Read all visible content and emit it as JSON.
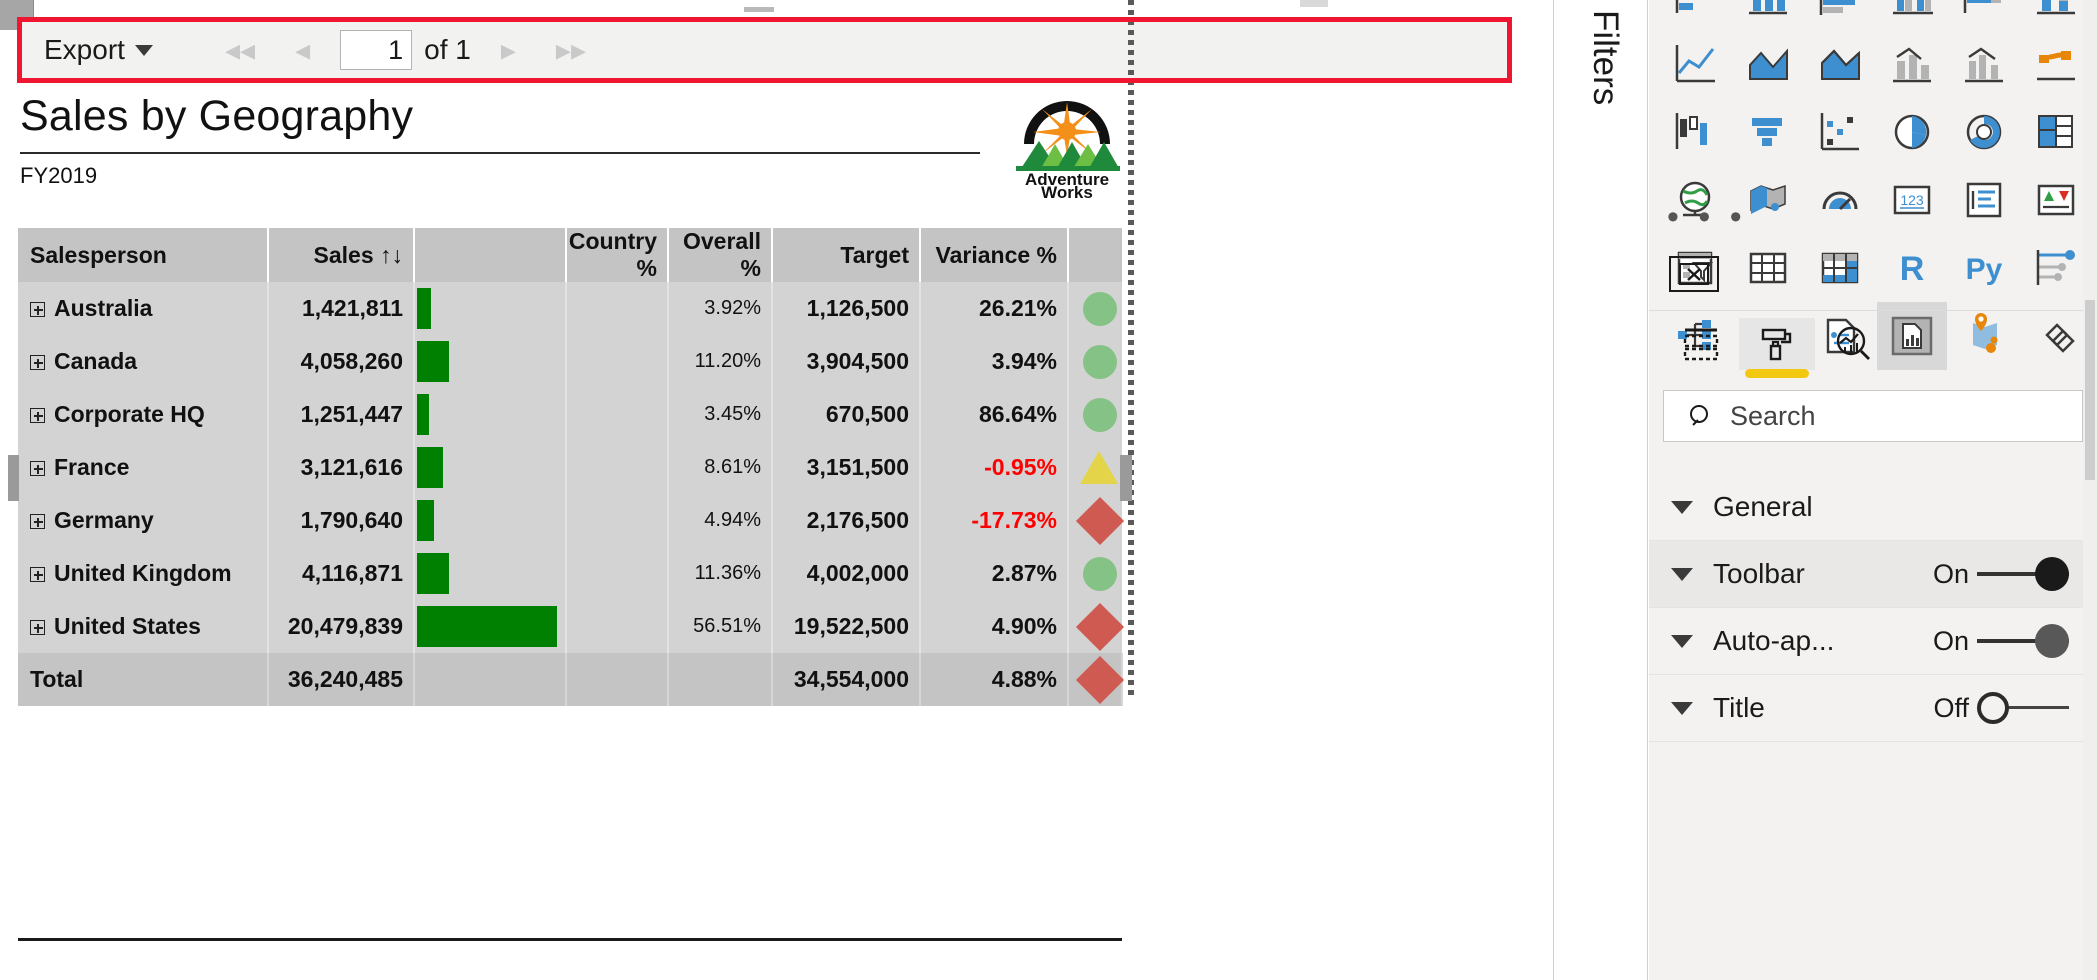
{
  "toolbar": {
    "export_label": "Export",
    "page_current": "1",
    "page_of": "of 1",
    "first_icon": "first-page-icon",
    "prev_icon": "previous-page-icon",
    "next_icon": "next-page-icon",
    "last_icon": "last-page-icon"
  },
  "report": {
    "title": "Sales by Geography",
    "subtitle": "FY2019",
    "logo_line1": "Adventure",
    "logo_line2": "Works"
  },
  "table": {
    "columns": [
      "Salesperson",
      "Sales",
      "",
      "Country %",
      "Overall %",
      "Target",
      "Variance %",
      ""
    ],
    "sort_indicator": "↑↓",
    "rows": [
      {
        "name": "Australia",
        "sales": "1,421,811",
        "bar_pct": 9,
        "country": "",
        "overall": "3.92%",
        "target": "1,126,500",
        "variance": "26.21%",
        "negative": false,
        "kpi": "circle"
      },
      {
        "name": "Canada",
        "sales": "4,058,260",
        "bar_pct": 21,
        "country": "",
        "overall": "11.20%",
        "target": "3,904,500",
        "variance": "3.94%",
        "negative": false,
        "kpi": "circle"
      },
      {
        "name": "Corporate HQ",
        "sales": "1,251,447",
        "bar_pct": 8,
        "country": "",
        "overall": "3.45%",
        "target": "670,500",
        "variance": "86.64%",
        "negative": false,
        "kpi": "circle"
      },
      {
        "name": "France",
        "sales": "3,121,616",
        "bar_pct": 17,
        "country": "",
        "overall": "8.61%",
        "target": "3,151,500",
        "variance": "-0.95%",
        "negative": true,
        "kpi": "triangle"
      },
      {
        "name": "Germany",
        "sales": "1,790,640",
        "bar_pct": 11,
        "country": "",
        "overall": "4.94%",
        "target": "2,176,500",
        "variance": "-17.73%",
        "negative": true,
        "kpi": "diamond"
      },
      {
        "name": "United Kingdom",
        "sales": "4,116,871",
        "bar_pct": 21,
        "country": "",
        "overall": "11.36%",
        "target": "4,002,000",
        "variance": "2.87%",
        "negative": false,
        "kpi": "circle"
      },
      {
        "name": "United States",
        "sales": "20,479,839",
        "bar_pct": 93,
        "country": "",
        "overall": "56.51%",
        "target": "19,522,500",
        "variance": "4.90%",
        "negative": false,
        "kpi": "diamond"
      }
    ],
    "total": {
      "name": "Total",
      "sales": "36,240,485",
      "country": "",
      "overall": "",
      "target": "34,554,000",
      "variance": "4.88%",
      "negative": false,
      "kpi": "diamond"
    }
  },
  "filters_rail": {
    "label": "Filters"
  },
  "viz_pane": {
    "more_label": "• • •",
    "icons": [
      "stacked-bar-chart-icon",
      "stacked-column-chart-icon",
      "clustered-bar-chart-icon",
      "clustered-column-chart-icon",
      "100-stacked-bar-chart-icon",
      "100-stacked-column-chart-icon",
      "line-chart-icon",
      "area-chart-icon",
      "stacked-area-chart-icon",
      "line-stacked-column-icon",
      "line-clustered-column-icon",
      "ribbon-chart-icon",
      "waterfall-chart-icon",
      "funnel-chart-icon",
      "scatter-chart-icon",
      "pie-chart-icon",
      "donut-chart-icon",
      "treemap-icon",
      "map-icon",
      "filled-map-icon",
      "gauge-icon",
      "card-icon",
      "multi-row-card-icon",
      "kpi-icon",
      "slicer-icon",
      "table-icon",
      "matrix-icon",
      "r-script-visual-icon",
      "python-visual-icon",
      "key-influencers-icon",
      "decomposition-tree-icon",
      "q-and-a-icon",
      "smart-narrative-icon",
      "paginated-report-icon",
      "azure-map-icon",
      "power-apps-icon"
    ],
    "fields_button_icon": "collapse-fields-icon",
    "tabs": [
      {
        "name": "fields-tab",
        "icon": "fields-build-icon",
        "active": false
      },
      {
        "name": "format-tab",
        "icon": "paint-roller-icon",
        "active": true
      },
      {
        "name": "analytics-tab",
        "icon": "analytics-magnifier-icon",
        "active": false
      }
    ],
    "search": {
      "placeholder": "Search",
      "icon": "search-icon"
    },
    "sections": [
      {
        "label": "General",
        "state": "",
        "toggle": "none"
      },
      {
        "label": "Toolbar",
        "state": "On",
        "toggle": "on-dark",
        "highlighted": true
      },
      {
        "label": "Auto-ap...",
        "state": "On",
        "toggle": "on-gray"
      },
      {
        "label": "Title",
        "state": "Off",
        "toggle": "off"
      }
    ]
  },
  "colors": {
    "highlight_red": "#f01632",
    "bar_green": "#008000",
    "kpi_green": "#85c285",
    "kpi_yellow": "#e4d44a",
    "kpi_red": "#cf5a52",
    "negative_text": "#ff0000",
    "accent_yellow": "#f2c811",
    "header_gray": "#c4c4c4",
    "row_gray": "#d3d3d3"
  }
}
